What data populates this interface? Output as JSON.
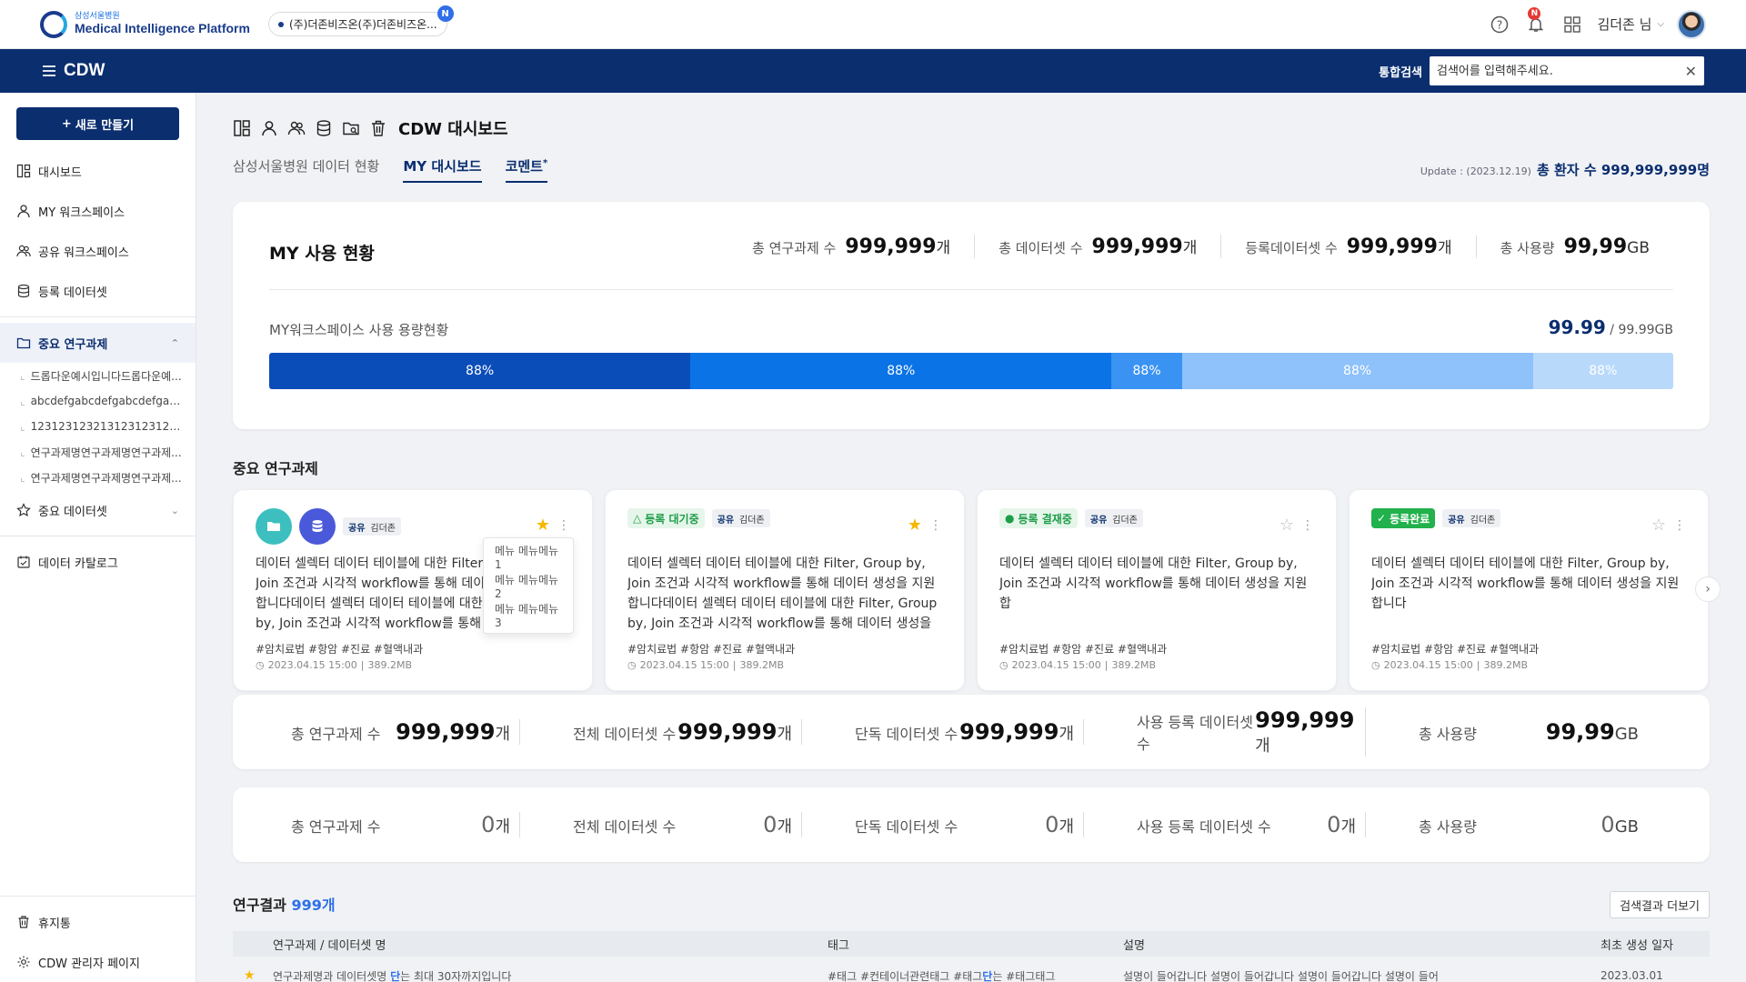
{
  "header": {
    "logo_sub": "삼성서울병원",
    "logo_main": "Medical Intelligence Platform",
    "org": "(주)더존비즈온(주)더존비즈온...",
    "org_badge": "N",
    "notif_badge": "N",
    "user": "김더존 님"
  },
  "nav": {
    "title": "CDW",
    "search_label": "통합검색",
    "search_placeholder": "검색어를 입력해주세요."
  },
  "sidebar": {
    "new_button": "새로 만들기",
    "items": [
      "대시보드",
      "MY 워크스페이스",
      "공유 워크스페이스",
      "등록 데이터셋",
      "중요 연구과제"
    ],
    "sub_items": [
      "드롭다운예시입니다드롭다운예...",
      "abcdefgabcdefgabcdefgabc...",
      "12312312321312312312312...",
      "연구과제명연구과제명연구과제...",
      "연구과제명연구과제명연구과제..."
    ],
    "important_datasets": "중요 데이터셋",
    "data_catalog": "데이터 카탈로그",
    "trash": "휴지통",
    "admin": "CDW 관리자 페이지"
  },
  "page": {
    "title": "CDW 대시보드",
    "tabs": [
      "삼성서울병원 데이터 현황",
      "MY 대시보드",
      "코멘트"
    ],
    "tab_mark": "*",
    "update_label": "Update : (2023.12.19)",
    "total_patients_label": "총 환자 수",
    "total_patients": "999,999,999명"
  },
  "usage": {
    "title": "MY 사용 현황",
    "stats": [
      {
        "label": "총 연구과제 수",
        "value": "999,999",
        "unit": "개"
      },
      {
        "label": "총 데이터셋 수",
        "value": "999,999",
        "unit": "개"
      },
      {
        "label": "등록데이터셋 수",
        "value": "999,999",
        "unit": "개"
      },
      {
        "label": "총 사용량",
        "value": "99,99",
        "unit": "GB"
      }
    ],
    "ws_label": "MY워크스페이스 사용 용량현황",
    "ws_used": "99.99",
    "ws_total": "/ 99.99GB",
    "segments": [
      {
        "label": "88%",
        "color": "#0b4db8",
        "share": 0.3
      },
      {
        "label": "88%",
        "color": "#0a73e6",
        "share": 0.3
      },
      {
        "label": "88%",
        "color": "#3a93f2",
        "share": 0.05
      },
      {
        "label": "88%",
        "color": "#8fc1fa",
        "share": 0.25
      },
      {
        "label": "88%",
        "color": "#b9d9fb",
        "share": 0.1
      }
    ]
  },
  "projects": {
    "title": "중요 연구과제",
    "share_label": "공유",
    "owner": "김더존",
    "tags": "#암치료법 #항암 #진료 #혈액내과",
    "date": "2023.04.15 15:00",
    "size": "389.2MB",
    "menu": [
      "메뉴 메뉴메뉴1",
      "메뉴 메뉴메뉴2",
      "메뉴 메뉴메뉴3"
    ],
    "cards": [
      {
        "status": "",
        "starred": true,
        "desc": "데이터 셀렉터 데이터 테이블에 대한 Filter, Group by, Join 조건과 시각적 workflow를 통해 데이터 생성을 지원합니다데이터 셀렉터 데이터 테이블에 대한 Filter, Group by, Join 조건과 시각적 workflow를 통해 데이터 생성을 지원합니다..."
      },
      {
        "status": "등록 대기중",
        "starred": true,
        "desc": "데이터 셀렉터 데이터 테이블에 대한 Filter, Group by, Join 조건과 시각적 workflow를 통해 데이터 생성을 지원합니다데이터 셀렉터 데이터 테이블에 대한 Filter, Group by, Join 조건과 시각적 workflow를 통해 데이터 생성을 지원합니다"
      },
      {
        "status": "등록 결재중",
        "starred": false,
        "desc": "데이터 셀렉터 데이터 테이블에 대한 Filter, Group by, Join 조건과 시각적 workflow를 통해 데이터 생성을 지원합"
      },
      {
        "status": "등록완료",
        "starred": false,
        "desc": "데이터 셀렉터 데이터 테이블에 대한 Filter, Group by, Join 조건과 시각적 workflow를 통해 데이터 생성을 지원합니다"
      }
    ]
  },
  "summary1": [
    {
      "label": "총 연구과제 수",
      "value": "999,999",
      "unit": "개"
    },
    {
      "label": "전체 데이터셋 수",
      "value": "999,999",
      "unit": "개"
    },
    {
      "label": "단독 데이터셋 수",
      "value": "999,999",
      "unit": "개"
    },
    {
      "label": "사용 등록 데이터셋 수",
      "value": "999,999",
      "unit": "개"
    },
    {
      "label": "총 사용량",
      "value": "99,99",
      "unit": "GB"
    }
  ],
  "summary2": [
    {
      "label": "총 연구과제 수",
      "value": "0",
      "unit": "개"
    },
    {
      "label": "전체 데이터셋 수",
      "value": "0",
      "unit": "개"
    },
    {
      "label": "단독 데이터셋 수",
      "value": "0",
      "unit": "개"
    },
    {
      "label": "사용 등록 데이터셋 수",
      "value": "0",
      "unit": "개"
    },
    {
      "label": "총 사용량",
      "value": "0",
      "unit": "GB"
    }
  ],
  "results": {
    "title": "연구결과",
    "count": "999개",
    "more": "검색결과 더보기",
    "columns": [
      "연구과제 / 데이터셋 명",
      "태그",
      "설명",
      "최초 생성 일자"
    ],
    "row": {
      "name": "연구과제명과 데이터셋명 ",
      "name_hl": "단",
      "name_rest": "는 최대 30자까지입니다",
      "tags": "#태그 #컨테이너관련태그 #태그",
      "tags_hl": "단",
      "tags_rest": "는 #태그태그",
      "desc": "설명이 들어갑니다 설명이 들어갑니다 설명이 들어갑니다 설명이 들어",
      "date": "2023.03.01"
    }
  }
}
